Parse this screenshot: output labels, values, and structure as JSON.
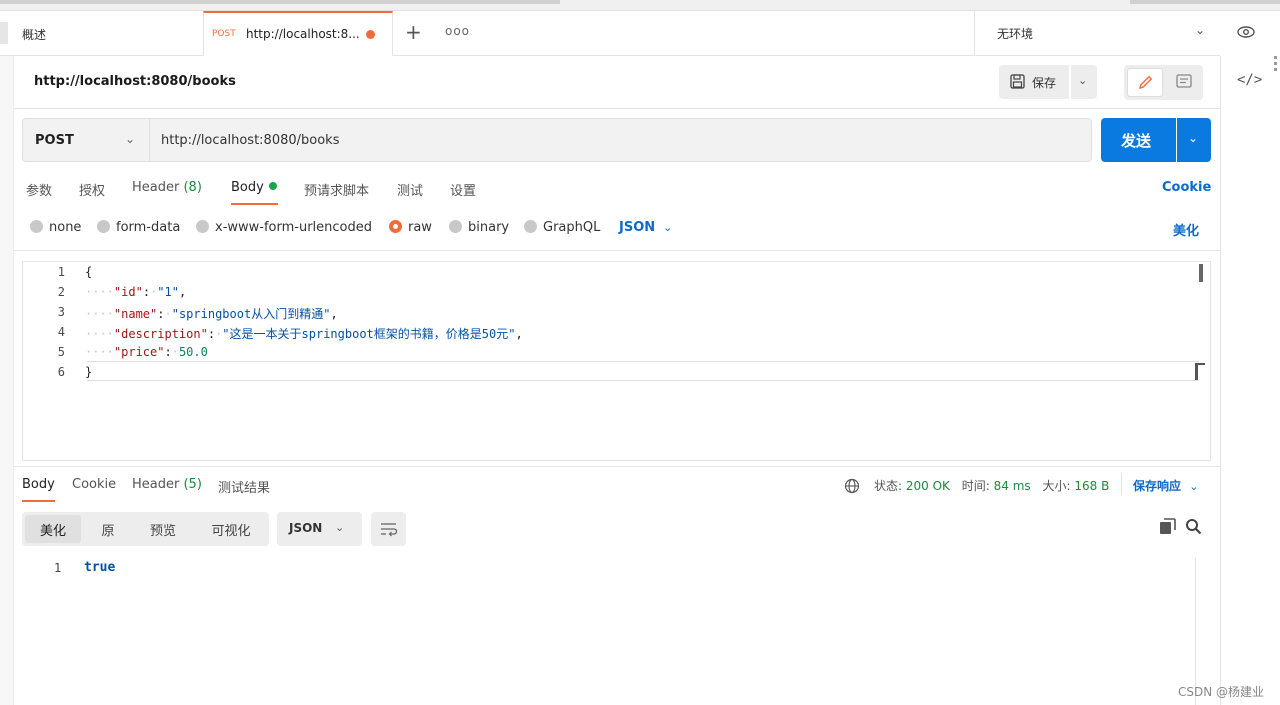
{
  "tabs": {
    "overview": "概述",
    "active_method": "POST",
    "active_url": "http://localhost:8...",
    "more": "ooo"
  },
  "environment": {
    "label": "无环境"
  },
  "request": {
    "title": "http://localhost:8080/books",
    "save_label": "保存",
    "method": "POST",
    "url": "http://localhost:8080/books",
    "send_label": "发送",
    "tabs": {
      "params": "参数",
      "auth": "授权",
      "header": "Header",
      "header_count": "(8)",
      "body": "Body",
      "pre_request": "预请求脚本",
      "tests": "测试",
      "settings": "设置"
    },
    "cookie_link": "Cookie",
    "body_types": [
      "none",
      "form-data",
      "x-www-form-urlencoded",
      "raw",
      "binary",
      "GraphQL"
    ],
    "selected_body_type": "raw",
    "format": "JSON",
    "beautify": "美化",
    "code": {
      "line_numbers": [
        "1",
        "2",
        "3",
        "4",
        "5",
        "6"
      ],
      "open": "{",
      "indent": "····",
      "id_key": "\"id\"",
      "id_val": "\"1\"",
      "name_key": "\"name\"",
      "name_val": "\"springboot从入门到精通\"",
      "desc_key": "\"description\"",
      "desc_val": "\"这是一本关于springboot框架的书籍，价格是50元\"",
      "price_key": "\"price\"",
      "price_val": "50.0",
      "close": "}"
    }
  },
  "response": {
    "tabs": {
      "body": "Body",
      "cookie": "Cookie",
      "header": "Header",
      "header_count": "(5)",
      "test_results": "测试结果"
    },
    "status_label": "状态:",
    "status_value": "200 OK",
    "time_label": "时间:",
    "time_value": "84 ms",
    "size_label": "大小:",
    "size_value": "168 B",
    "save_response": "保存响应",
    "views": [
      "美化",
      "原",
      "预览",
      "可视化"
    ],
    "selected_view": "美化",
    "format": "JSON",
    "line_number": "1",
    "value": "true"
  },
  "watermark": "CSDN @杨建业",
  "colors": {
    "accent": "#f26b3a",
    "primary": "#0b7ae0",
    "link": "#0b6bcb",
    "success": "#1c8a3c"
  }
}
